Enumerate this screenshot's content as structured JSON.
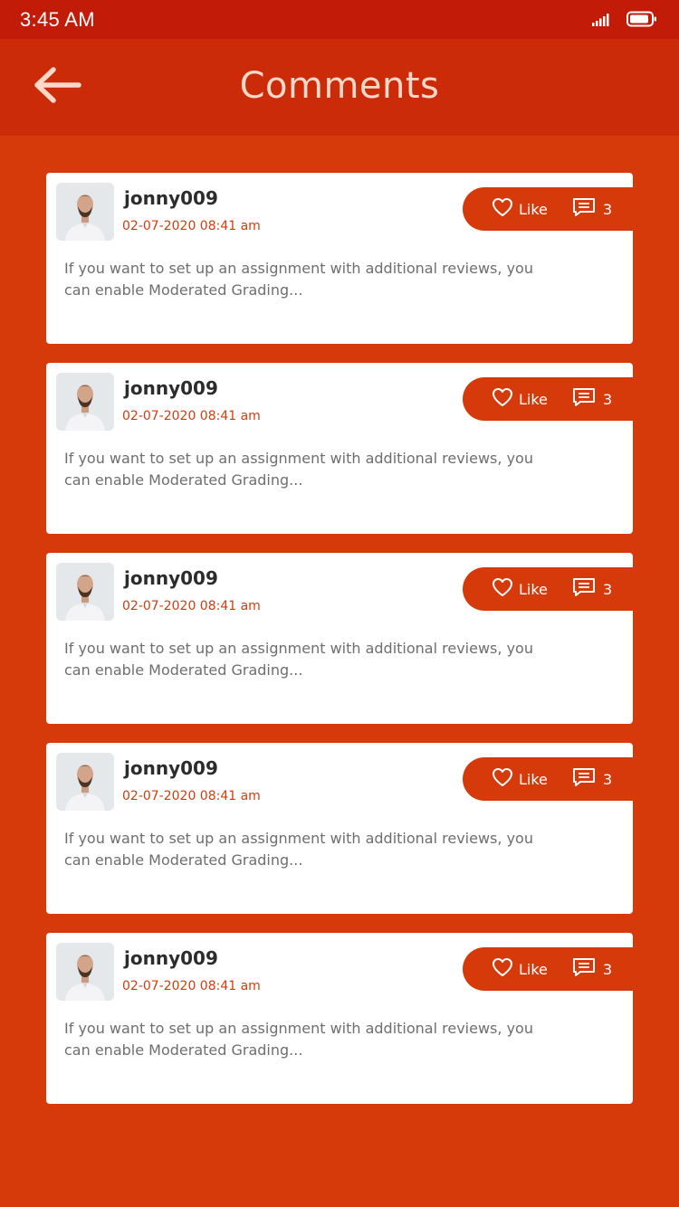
{
  "status_bar": {
    "time": "3:45 AM",
    "icons": [
      "signal-icon",
      "battery-icon"
    ]
  },
  "header": {
    "title": "Comments",
    "back_icon": "arrow-left-icon"
  },
  "colors": {
    "background": "#d63a0b",
    "status_bar": "#c21c08",
    "header": "#cb2b09",
    "title": "#fbd8c8",
    "accent": "#cf3d10",
    "card": "#ffffff"
  },
  "comments": [
    {
      "username": "jonny009",
      "timestamp": "02-07-2020 08:41 am",
      "text": "If you want to set up an assignment with additional reviews, you can enable Moderated Grading...",
      "like_label": "Like",
      "comment_count": "3"
    },
    {
      "username": "jonny009",
      "timestamp": "02-07-2020 08:41 am",
      "text": "If you want to set up an assignment with additional reviews, you can enable Moderated Grading...",
      "like_label": "Like",
      "comment_count": "3"
    },
    {
      "username": "jonny009",
      "timestamp": "02-07-2020 08:41 am",
      "text": "If you want to set up an assignment with additional reviews, you can enable Moderated Grading...",
      "like_label": "Like",
      "comment_count": "3"
    },
    {
      "username": "jonny009",
      "timestamp": "02-07-2020 08:41 am",
      "text": "If you want to set up an assignment with additional reviews, you can enable Moderated Grading...",
      "like_label": "Like",
      "comment_count": "3"
    },
    {
      "username": "jonny009",
      "timestamp": "02-07-2020 08:41 am",
      "text": "If you want to set up an assignment with additional reviews, you can enable Moderated Grading...",
      "like_label": "Like",
      "comment_count": "3"
    }
  ]
}
